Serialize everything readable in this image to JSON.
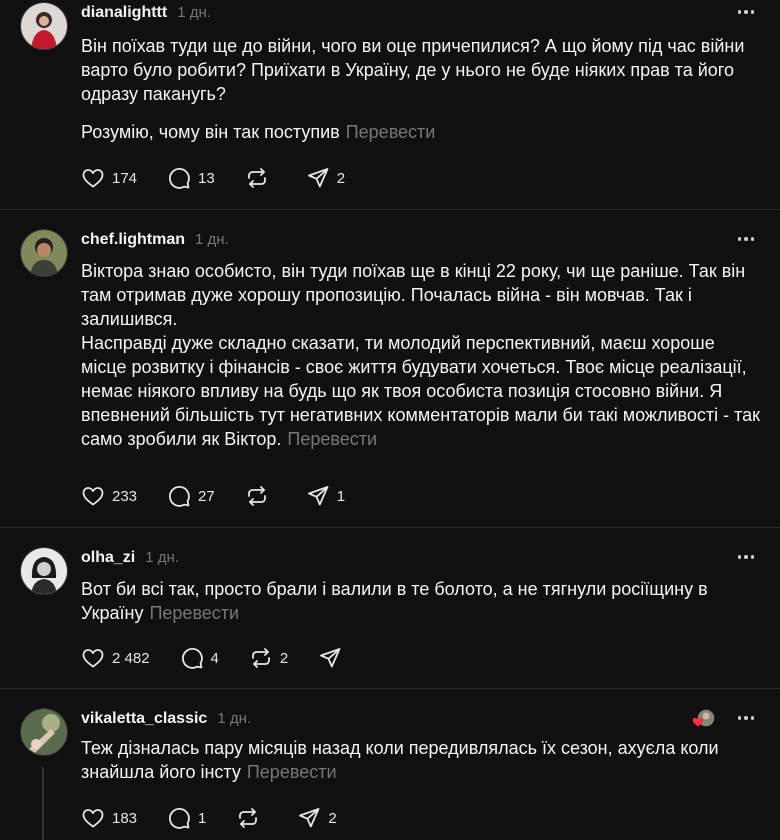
{
  "posts": [
    {
      "username": "dianalighttt",
      "time": "1 дн.",
      "paragraphs": [
        "Він поїхав туди ще до війни, чого ви оце причепилися? А що йому під час війни варто було робити? Приїхати в Україну, де у нього не буде ніяких прав та його одразу паканугь?"
      ],
      "last_paragraph": "Розумію, чому він так поступив",
      "translate": "Перевести",
      "likes": "174",
      "comments": "13",
      "reposts": "",
      "shares": "2"
    },
    {
      "username": "chef.lightman",
      "time": "1 дн.",
      "paragraphs": [
        "Віктора знаю особисто, він туди поїхав ще в кінці 22 року, чи ще раніше. Так він там отримав дуже хорошу пропозицію. Почалась війна - він мовчав. Так і залишився."
      ],
      "last_paragraph": "Насправді дуже складно сказати, ти молодий перспективний, маєш хороше місце розвитку і фінансів - своє життя будувати хочеться. Твоє місце реалізації, немає ніякого впливу на будь що як твоя особиста позиція стосовно війни. Я впевнений більшість тут негативних комментаторів мали би такі можливості - так само зробили як Віктор.",
      "translate": "Перевести",
      "likes": "233",
      "comments": "27",
      "reposts": "",
      "shares": "1"
    },
    {
      "username": "olha_zi",
      "time": "1 дн.",
      "paragraphs": [],
      "last_paragraph": "Вот би всі так, просто брали і валили в те болото, а не тягнули росіїщину в Україну",
      "translate": "Перевести",
      "likes": "2 482",
      "comments": "4",
      "reposts": "2",
      "shares": ""
    },
    {
      "username": "vikaletta_classic",
      "time": "1 дн.",
      "paragraphs": [],
      "last_paragraph": "Теж дізналась пару місяців назад коли передивлялась їх сезон, ахуєла коли знайшла його інсту",
      "translate": "Перевести",
      "likes": "183",
      "comments": "1",
      "reposts": "",
      "shares": "2"
    }
  ],
  "icons": {
    "like": "heart-icon",
    "comment": "comment-bubble-icon",
    "repost": "repost-icon",
    "share": "share-send-icon",
    "more": "more-dots-icon"
  },
  "colors": {
    "background": "#101010",
    "text": "#f3f5f7",
    "muted": "#777777",
    "divider": "#2b2b2b",
    "reaction_heart": "#ff3040"
  }
}
